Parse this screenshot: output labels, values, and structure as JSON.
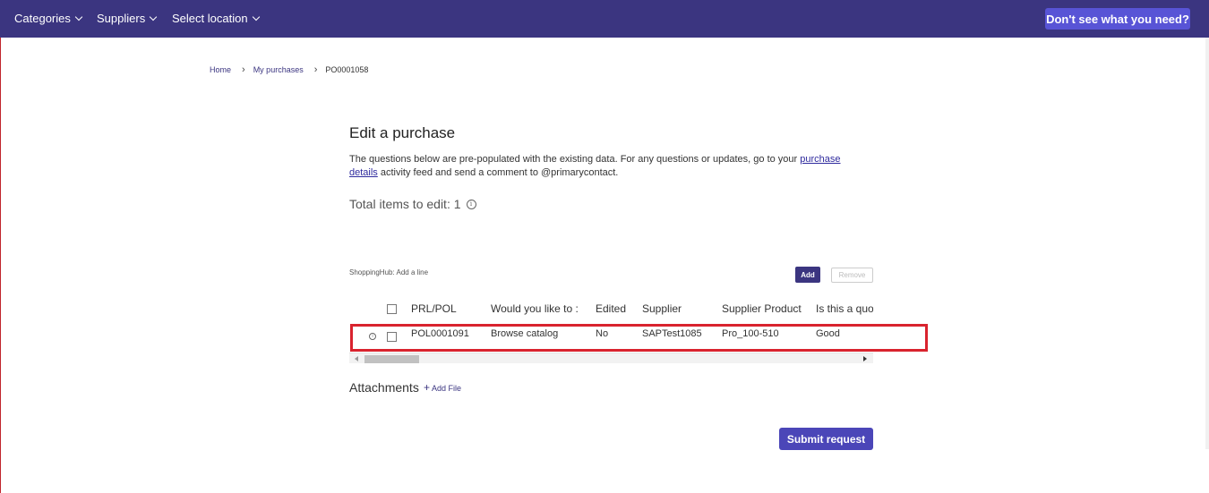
{
  "topnav": {
    "categories": "Categories",
    "suppliers": "Suppliers",
    "location": "Select location",
    "help_button": "Don't see what you need?"
  },
  "breadcrumb": {
    "home": "Home",
    "my_purchases": "My purchases",
    "current": "PO0001058"
  },
  "page": {
    "title": "Edit a purchase",
    "desc_before": "The questions below are pre-populated with the existing data.  For any questions or updates, go to your ",
    "desc_link": "purchase details",
    "desc_after": " activity feed and send a comment to @primarycontact.",
    "total_label": "Total items to edit: 1"
  },
  "table_section": {
    "label": "ShoppingHub: Add a line",
    "add_button": "Add",
    "remove_button": "Remove",
    "columns": [
      "PRL/POL",
      "Would you like to :",
      "Edited",
      "Supplier",
      "Supplier Product",
      "Is this a quo"
    ],
    "rows": [
      {
        "prl_pol": "POL0001091",
        "action": "Browse catalog",
        "edited": "No",
        "supplier": "SAPTest1085",
        "product": "Pro_100-510",
        "quote": "Good"
      }
    ]
  },
  "attachments": {
    "label": "Attachments",
    "add_file": "Add File"
  },
  "submit_button": "Submit request",
  "colors": {
    "navbar": "#3b3580",
    "accent_button": "#5854d6",
    "submit": "#4b46b8",
    "highlight": "#d9232e"
  }
}
